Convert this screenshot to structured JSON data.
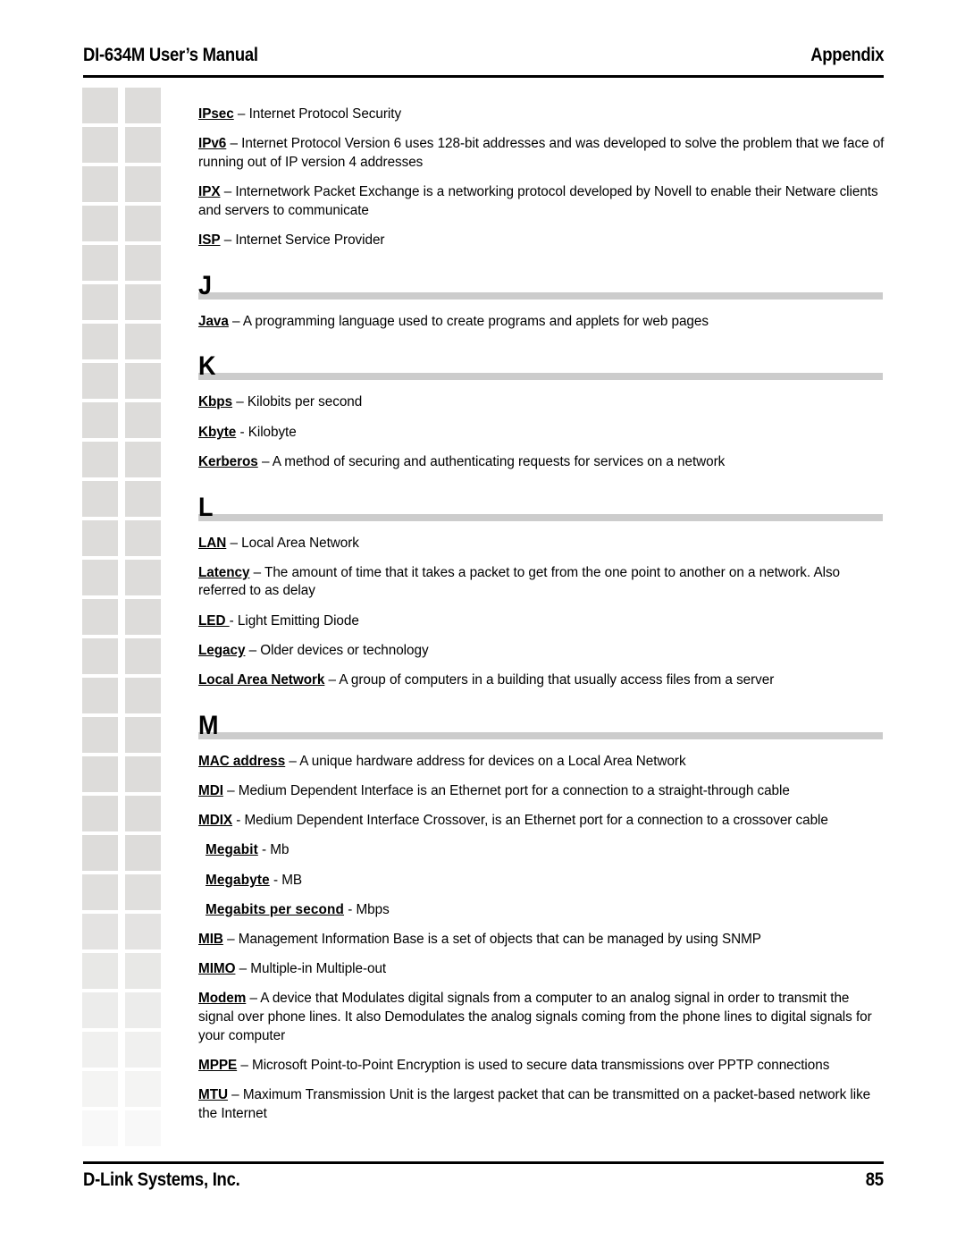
{
  "header": {
    "left": "DI-634M User’s Manual",
    "right": "Appendix"
  },
  "footer": {
    "left": "D-Link Systems, Inc.",
    "right": "85"
  },
  "decor": {
    "square_color": "#dddcda",
    "bar_color": "#cccccc",
    "rule_color": "#000000",
    "columns": 2,
    "rows": 27
  },
  "content": {
    "entries_i": [
      {
        "term": "IPsec",
        "definition": " – Internet Protocol Security"
      },
      {
        "term": "IPv6",
        "definition": " – Internet Protocol Version 6 uses 128-bit addresses and was developed to solve the problem that we face of running out of IP version 4 addresses"
      },
      {
        "term": "IPX",
        "definition": " – Internetwork Packet Exchange is a networking protocol developed by Novell to enable their Netware clients and servers to communicate"
      },
      {
        "term": "ISP",
        "definition": " – Internet Service Provider"
      }
    ],
    "section_j": {
      "letter": "J",
      "entries": [
        {
          "term": "Java",
          "definition": " – A programming language used to create programs and applets for web pages"
        }
      ]
    },
    "section_k": {
      "letter": "K",
      "entries": [
        {
          "term": "Kbps",
          "definition": " – Kilobits per second"
        },
        {
          "term": "Kbyte",
          "definition": " - Kilobyte"
        },
        {
          "term": "Kerberos",
          "definition": " – A method of securing and authenticating requests for services on a network"
        }
      ]
    },
    "section_l": {
      "letter": "L",
      "entries": [
        {
          "term": "LAN",
          "definition": " – Local Area Network"
        },
        {
          "term": "Latency",
          "definition": " – The amount of time that it takes a packet to get from the one point to another on a network.  Also referred to as delay"
        },
        {
          "term": "LED ",
          "definition": " - Light Emitting Diode"
        },
        {
          "term": "Legacy",
          "definition": " – Older devices or technology"
        },
        {
          "term": "Local Area Network",
          "definition": " – A group of computers in a building that usually access files from a server"
        }
      ]
    },
    "section_m": {
      "letter": "M",
      "entries": [
        {
          "term": "MAC address",
          "definition": " – A unique hardware address for devices on a Local Area Network",
          "indented": false
        },
        {
          "term": "MDI",
          "definition": " – Medium Dependent Interface is an Ethernet port for a connection to a straight-through cable",
          "indented": false
        },
        {
          "term": "MDIX",
          "definition": " - Medium Dependent Interface Crossover, is an Ethernet port for a connection to a crossover cable",
          "indented": false
        },
        {
          "term": "Megabit",
          "definition": " - Mb",
          "indented": true
        },
        {
          "term": "Megabyte",
          "definition": " - MB",
          "indented": true
        },
        {
          "term": "Megabits per second",
          "definition": " - Mbps",
          "indented": true
        },
        {
          "term": "MIB",
          "definition": " – Management Information Base is a set of objects that can be managed by using SNMP",
          "indented": false
        },
        {
          "term": "MIMO",
          "definition": " – Multiple-in Multiple-out",
          "indented": false
        },
        {
          "term": "Modem",
          "definition": " – A device that Modulates digital signals from a computer to an analog signal in order to transmit the signal over phone lines.  It also Demodulates the analog signals coming from the phone lines to digital signals for your computer",
          "indented": false
        },
        {
          "term": "MPPE",
          "definition": " – Microsoft Point-to-Point Encryption is used to secure data transmissions over PPTP connections",
          "indented": false
        },
        {
          "term": "MTU",
          "definition": " – Maximum Transmission Unit is the largest packet that can be transmitted on a packet-based network like the Internet",
          "indented": false
        }
      ]
    }
  }
}
